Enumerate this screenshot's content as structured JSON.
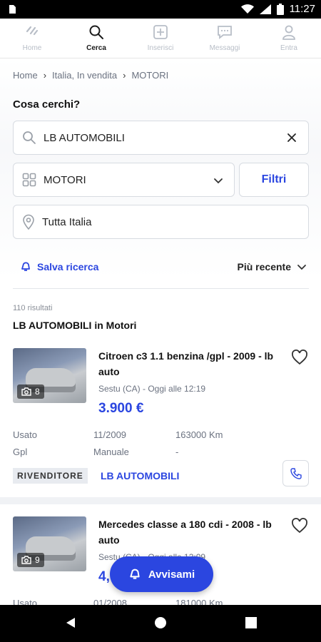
{
  "status_bar": {
    "time": "11:27"
  },
  "top_nav": {
    "items": [
      {
        "label": "Home",
        "icon": "home-icon"
      },
      {
        "label": "Cerca",
        "icon": "search-icon"
      },
      {
        "label": "Inserisci",
        "icon": "plus-square-icon"
      },
      {
        "label": "Messaggi",
        "icon": "chat-icon"
      },
      {
        "label": "Entra",
        "icon": "user-icon"
      }
    ],
    "active": "Cerca"
  },
  "breadcrumb": [
    "Home",
    "Italia, In vendita",
    "MOTORI"
  ],
  "search": {
    "title": "Cosa cerchi?",
    "query": "LB AUTOMOBILI",
    "category": "MOTORI",
    "filters_label": "Filtri",
    "location": "Tutta Italia"
  },
  "actions": {
    "save_search": "Salva ricerca",
    "sort": "Più recente"
  },
  "results": {
    "count": "110 risultati",
    "title": "LB AUTOMOBILI in Motori"
  },
  "listings": [
    {
      "title": "Citroen c3 1.1 benzina /gpl - 2009 - lb auto",
      "location_time": "Sestu (CA) - Oggi alle 12:19",
      "price": "3.900 €",
      "photos": "8",
      "condition": "Usato",
      "date": "11/2009",
      "km": "163000 Km",
      "fuel": "Gpl",
      "gearbox": "Manuale",
      "extra": "-",
      "seller_type": "RIVENDITORE",
      "seller_name": "LB AUTOMOBILI"
    },
    {
      "title": "Mercedes classe a 180 cdi - 2008 - lb auto",
      "location_time": "Sestu (CA) - Oggi alle 12:09",
      "price": "4,",
      "photos": "9",
      "condition": "Usato",
      "date": "01/2008",
      "km": "181000 Km"
    }
  ],
  "fab": {
    "label": "Avvisami"
  },
  "colors": {
    "accent": "#2b46e0",
    "muted": "#b8bec7"
  }
}
